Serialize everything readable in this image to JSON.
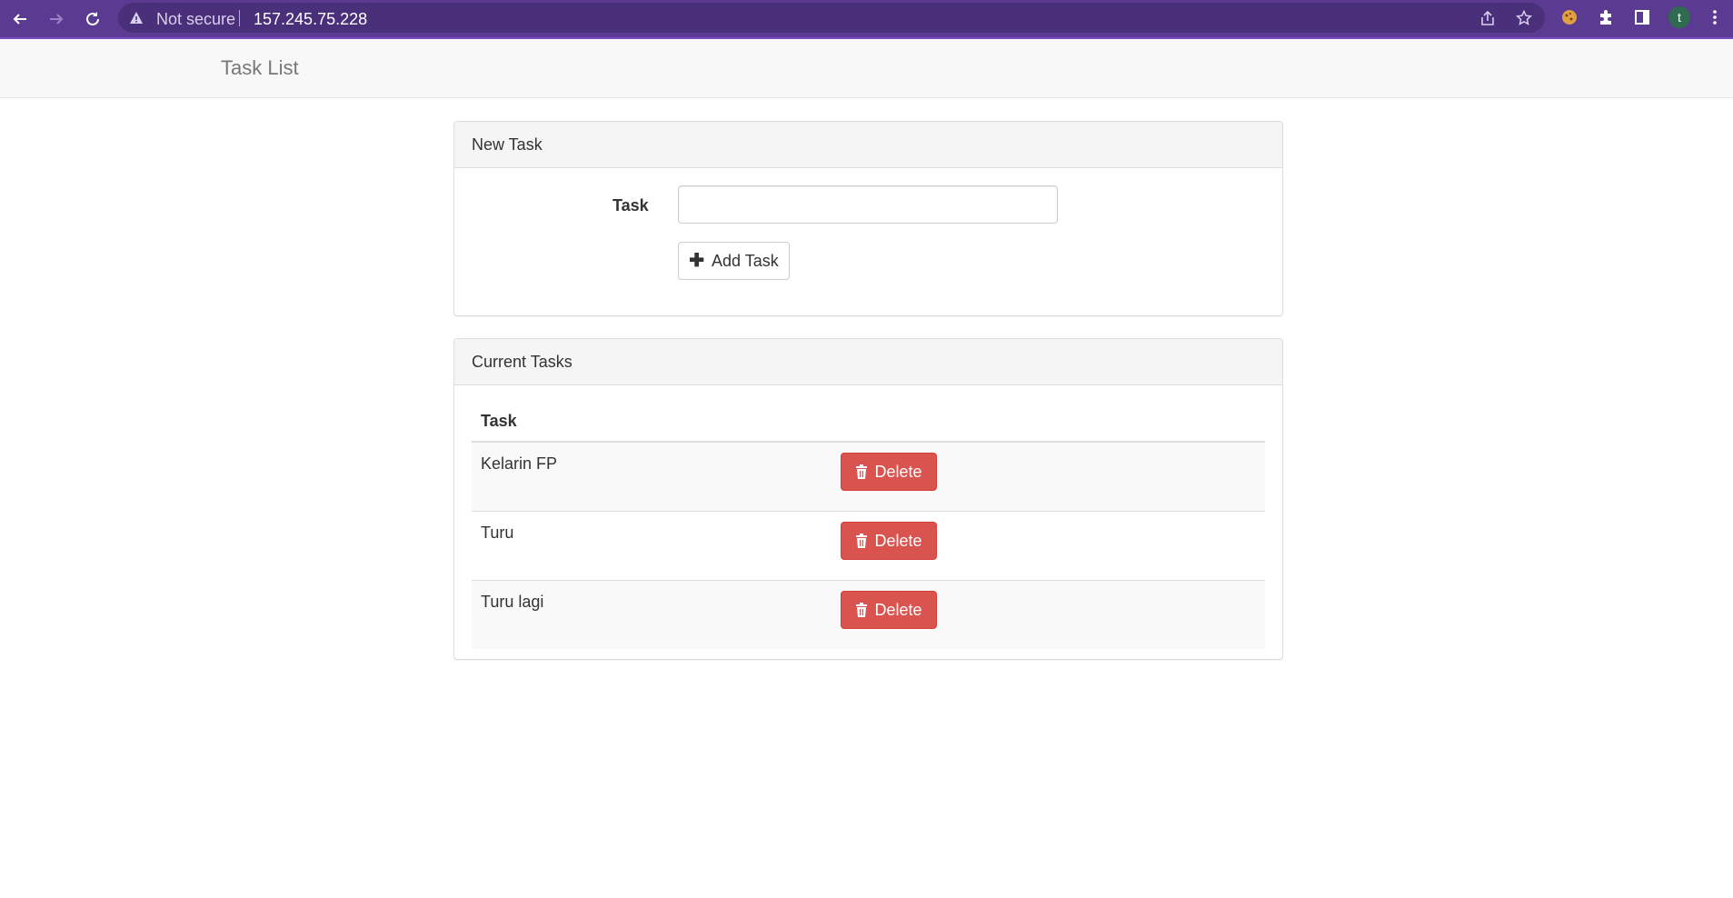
{
  "browser": {
    "security_label": "Not secure",
    "url": "157.245.75.228",
    "profile_initial": "t"
  },
  "navbar": {
    "brand": "Task List"
  },
  "new_task_panel": {
    "title": "New Task",
    "field_label": "Task",
    "input_value": "",
    "add_button_label": "Add Task"
  },
  "current_tasks_panel": {
    "title": "Current Tasks",
    "column_header": "Task",
    "delete_label": "Delete",
    "tasks": [
      {
        "name": "Kelarin FP"
      },
      {
        "name": "Turu"
      },
      {
        "name": "Turu lagi"
      }
    ]
  }
}
